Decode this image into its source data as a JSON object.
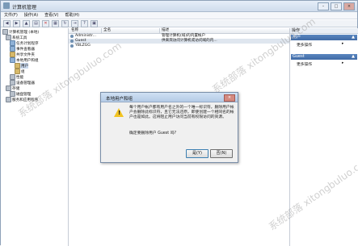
{
  "window": {
    "title": "计算机管理",
    "buttons": [
      "–",
      "□",
      "×"
    ]
  },
  "menu": [
    "文件(F)",
    "操作(A)",
    "查看(V)",
    "帮助(H)"
  ],
  "toolbar": {
    "icons": [
      "back-icon",
      "forward-icon",
      "up-icon",
      "show-hide-icon",
      "delete-icon",
      "properties-icon",
      "refresh-icon",
      "export-icon",
      "help-icon",
      "view-icon"
    ]
  },
  "tree": {
    "items": [
      {
        "label": "计算机管理 (本地)",
        "indent": 0
      },
      {
        "label": "系统工具",
        "indent": 1
      },
      {
        "label": "任务计划程序",
        "indent": 2
      },
      {
        "label": "事件查看器",
        "indent": 2
      },
      {
        "label": "共享文件夹",
        "indent": 2
      },
      {
        "label": "本地用户和组",
        "indent": 2
      },
      {
        "label": "用户",
        "indent": 3
      },
      {
        "label": "组",
        "indent": 3
      },
      {
        "label": "性能",
        "indent": 2
      },
      {
        "label": "设备管理器",
        "indent": 2
      },
      {
        "label": "存储",
        "indent": 1
      },
      {
        "label": "磁盘管理",
        "indent": 2
      },
      {
        "label": "服务和应用程序",
        "indent": 1
      }
    ]
  },
  "list": {
    "columns": [
      "名称",
      "全名",
      "描述"
    ],
    "rows": [
      {
        "name": "Administr...",
        "full": "",
        "desc": "管理计算机(域)的内置帐户"
      },
      {
        "name": "Guest",
        "full": "",
        "desc": "供来宾访问计算机或访问域的内..."
      },
      {
        "name": "YBLZGG",
        "full": "",
        "desc": ""
      }
    ]
  },
  "actions": {
    "header": "操作",
    "sections": [
      {
        "title": "用户",
        "item": "更多操作"
      },
      {
        "title": "Guest",
        "item": "更多操作"
      }
    ]
  },
  "dialog": {
    "title": "本地用户和组",
    "message": "每个用户帐户都有用户名之外的一个唯一标识符。删除用户帐户会删除此标识符，且它无法还原。即使创建一个相同名的帐户也是如此。这将阻止用户访问当前有权限访问的资源。",
    "confirm": "确定要删除用户 Guest 吗?",
    "yes": "是(Y)",
    "no": "否(N)"
  },
  "watermark": "系统部落 xitongbuluo.com"
}
